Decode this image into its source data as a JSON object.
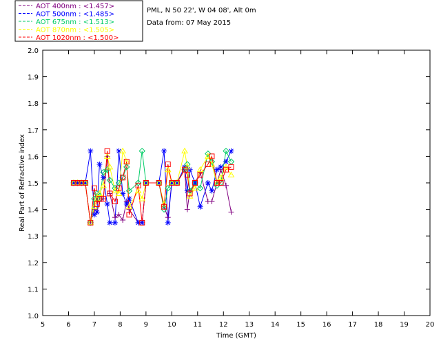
{
  "chart_data": {
    "type": "line",
    "xlabel": "Time (GMT)",
    "ylabel": "Real Part of Refractive index",
    "xlim": [
      5,
      20
    ],
    "ylim": [
      1.0,
      2.0
    ],
    "x_ticks": [
      5,
      6,
      7,
      8,
      9,
      10,
      11,
      12,
      13,
      14,
      15,
      16,
      17,
      18,
      19,
      20
    ],
    "y_ticks": [
      1.0,
      1.1,
      1.2,
      1.3,
      1.4,
      1.5,
      1.6,
      1.7,
      1.8,
      1.9,
      2.0
    ],
    "grid": false,
    "info_lines": [
      "PML, N 50 22', W 04 08', Alt 0m",
      "Data from: 07 May 2015"
    ],
    "legend_position": "top-left, outside plot",
    "series": [
      {
        "name": "AOT  400nm : <1.457>",
        "color": "#800080",
        "marker": "plus",
        "x": [
          6.2,
          6.35,
          6.5,
          6.65,
          6.85,
          7.0,
          7.1,
          7.2,
          7.35,
          7.5,
          7.6,
          7.8,
          7.95,
          8.1,
          8.25,
          8.35,
          8.7,
          8.85,
          9.0,
          9.5,
          9.7,
          9.85,
          10.0,
          10.2,
          10.5,
          10.6,
          10.7,
          10.9,
          11.1,
          11.4,
          11.55,
          11.75,
          11.9,
          12.1,
          12.3
        ],
        "y": [
          1.5,
          1.5,
          1.5,
          1.5,
          1.35,
          1.4,
          1.39,
          1.43,
          1.44,
          1.6,
          1.46,
          1.37,
          1.38,
          1.36,
          1.43,
          1.4,
          1.35,
          1.35,
          1.5,
          1.5,
          1.41,
          1.37,
          1.5,
          1.5,
          1.55,
          1.4,
          1.47,
          1.5,
          1.54,
          1.43,
          1.43,
          1.5,
          1.55,
          1.49,
          1.39
        ]
      },
      {
        "name": "AOT  500nm : <1.485>",
        "color": "#0000ff",
        "marker": "star",
        "x": [
          6.2,
          6.35,
          6.5,
          6.65,
          6.85,
          7.0,
          7.1,
          7.2,
          7.35,
          7.5,
          7.6,
          7.8,
          7.95,
          8.1,
          8.25,
          8.35,
          8.7,
          8.85,
          9.0,
          9.5,
          9.7,
          9.85,
          10.0,
          10.2,
          10.5,
          10.6,
          10.7,
          10.9,
          11.1,
          11.4,
          11.55,
          11.75,
          11.9,
          12.1,
          12.3
        ],
        "y": [
          1.5,
          1.5,
          1.5,
          1.5,
          1.62,
          1.38,
          1.39,
          1.57,
          1.52,
          1.42,
          1.35,
          1.35,
          1.62,
          1.46,
          1.42,
          1.44,
          1.35,
          1.35,
          1.5,
          1.5,
          1.62,
          1.35,
          1.5,
          1.5,
          1.56,
          1.47,
          1.55,
          1.5,
          1.41,
          1.5,
          1.47,
          1.55,
          1.56,
          1.58,
          1.62
        ]
      },
      {
        "name": "AOT  675nm : <1.513>",
        "color": "#00cc66",
        "marker": "diamond",
        "x": [
          6.2,
          6.35,
          6.5,
          6.65,
          6.85,
          7.0,
          7.1,
          7.2,
          7.35,
          7.5,
          7.6,
          7.8,
          7.95,
          8.1,
          8.25,
          8.35,
          8.7,
          8.85,
          9.0,
          9.5,
          9.7,
          9.85,
          10.0,
          10.2,
          10.5,
          10.6,
          10.7,
          10.9,
          11.1,
          11.4,
          11.55,
          11.75,
          11.9,
          12.1,
          12.3
        ],
        "y": [
          1.5,
          1.5,
          1.5,
          1.5,
          1.35,
          1.44,
          1.46,
          1.44,
          1.54,
          1.55,
          1.51,
          1.48,
          1.5,
          1.52,
          1.56,
          1.47,
          1.5,
          1.62,
          1.5,
          1.5,
          1.4,
          1.48,
          1.5,
          1.5,
          1.55,
          1.57,
          1.47,
          1.5,
          1.48,
          1.61,
          1.58,
          1.49,
          1.5,
          1.62,
          1.58
        ]
      },
      {
        "name": "AOT  870nm : <1.505>",
        "color": "#ffff00",
        "marker": "triangle",
        "x": [
          6.2,
          6.35,
          6.5,
          6.65,
          6.85,
          7.0,
          7.1,
          7.2,
          7.35,
          7.5,
          7.6,
          7.8,
          7.95,
          8.1,
          8.25,
          8.35,
          8.7,
          8.85,
          9.0,
          9.5,
          9.7,
          9.85,
          10.0,
          10.2,
          10.5,
          10.6,
          10.7,
          10.9,
          11.1,
          11.4,
          11.55,
          11.75,
          11.9,
          12.1,
          12.3
        ],
        "y": [
          1.5,
          1.5,
          1.5,
          1.5,
          1.35,
          1.41,
          1.44,
          1.46,
          1.49,
          1.6,
          1.56,
          1.47,
          1.46,
          1.62,
          1.58,
          1.41,
          1.47,
          1.44,
          1.5,
          1.5,
          1.42,
          1.55,
          1.5,
          1.5,
          1.62,
          1.56,
          1.45,
          1.48,
          1.55,
          1.6,
          1.57,
          1.5,
          1.52,
          1.56,
          1.53
        ]
      },
      {
        "name": "AOT 1020nm : <1.500>",
        "color": "#ff0000",
        "marker": "square",
        "x": [
          6.2,
          6.35,
          6.5,
          6.65,
          6.85,
          7.0,
          7.1,
          7.2,
          7.35,
          7.5,
          7.6,
          7.8,
          7.95,
          8.1,
          8.25,
          8.35,
          8.7,
          8.85,
          9.0,
          9.5,
          9.7,
          9.85,
          10.0,
          10.2,
          10.5,
          10.6,
          10.7,
          10.9,
          11.1,
          11.4,
          11.55,
          11.75,
          11.9,
          12.1,
          12.3
        ],
        "y": [
          1.5,
          1.5,
          1.5,
          1.5,
          1.35,
          1.48,
          1.42,
          1.44,
          1.44,
          1.62,
          1.46,
          1.43,
          1.48,
          1.52,
          1.58,
          1.38,
          1.49,
          1.35,
          1.5,
          1.5,
          1.41,
          1.57,
          1.5,
          1.5,
          1.55,
          1.53,
          1.46,
          1.5,
          1.53,
          1.57,
          1.6,
          1.5,
          1.5,
          1.55,
          1.56
        ]
      }
    ]
  },
  "legend": {
    "entries": [
      {
        "label": "AOT  400nm : <1.457>",
        "color": "#800080"
      },
      {
        "label": "AOT  500nm : <1.485>",
        "color": "#0000ff"
      },
      {
        "label": "AOT  675nm : <1.513>",
        "color": "#00cc66"
      },
      {
        "label": "AOT  870nm : <1.505>",
        "color": "#ffff00"
      },
      {
        "label": "AOT 1020nm : <1.500>",
        "color": "#ff0000"
      }
    ]
  }
}
